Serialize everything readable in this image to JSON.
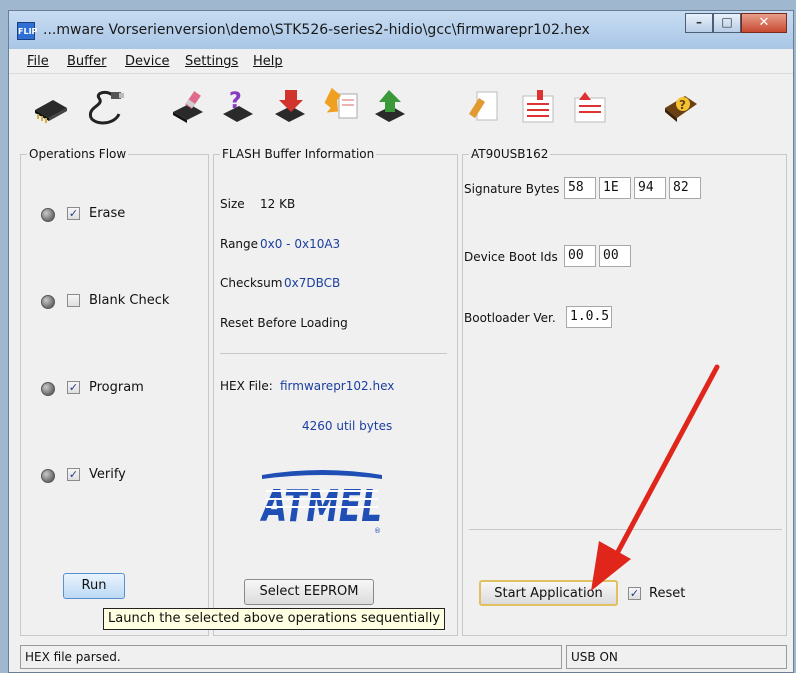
{
  "window": {
    "title": "...mware Vorserienversion\\demo\\STK526-series2-hidio\\gcc\\firmwarepr102.hex",
    "app_icon_text": "FLIP"
  },
  "menu": [
    "File",
    "Buffer",
    "Device",
    "Settings",
    "Help"
  ],
  "toolbar_icons": [
    "select-device-icon",
    "usb-communication-icon",
    "erase-icon",
    "blank-check-icon",
    "program-icon",
    "read-icon",
    "verify-icon",
    "load-hex-icon",
    "edit-buffer-icon",
    "save-buffer-icon",
    "help-book-icon"
  ],
  "operations_flow": {
    "legend": "Operations Flow",
    "items": [
      {
        "label": "Erase",
        "checked": true
      },
      {
        "label": "Blank Check",
        "checked": false
      },
      {
        "label": "Program",
        "checked": true
      },
      {
        "label": "Verify",
        "checked": true
      }
    ],
    "run_label": "Run",
    "tooltip": "Launch the selected above operations sequentially"
  },
  "flash_buffer": {
    "legend": "FLASH Buffer Information",
    "size_label": "Size",
    "size_value": "12 KB",
    "range_label": "Range",
    "range_value": "0x0 - 0x10A3",
    "checksum_label": "Checksum",
    "checksum_value": "0x7DBCB",
    "reset_before_loading": "Reset Before Loading",
    "hex_file_label": "HEX File:",
    "hex_file_value": "firmwarepr102.hex",
    "util_bytes": "4260 util bytes",
    "logo_text": "ATMEL",
    "select_eeprom_label": "Select EEPROM"
  },
  "device": {
    "legend": "AT90USB162",
    "signature_label": "Signature Bytes",
    "signature_bytes": [
      "58",
      "1E",
      "94",
      "82"
    ],
    "boot_ids_label": "Device Boot Ids",
    "boot_ids": [
      "00",
      "00"
    ],
    "bootloader_label": "Bootloader Ver.",
    "bootloader_value": "1.0.5",
    "start_application_label": "Start Application",
    "reset_label": "Reset",
    "reset_checked": true
  },
  "status": {
    "left": "HEX file parsed.",
    "right": "USB ON"
  },
  "colors": {
    "atmel_blue": "#1f4fb5",
    "annotation_arrow": "#e0251b"
  }
}
